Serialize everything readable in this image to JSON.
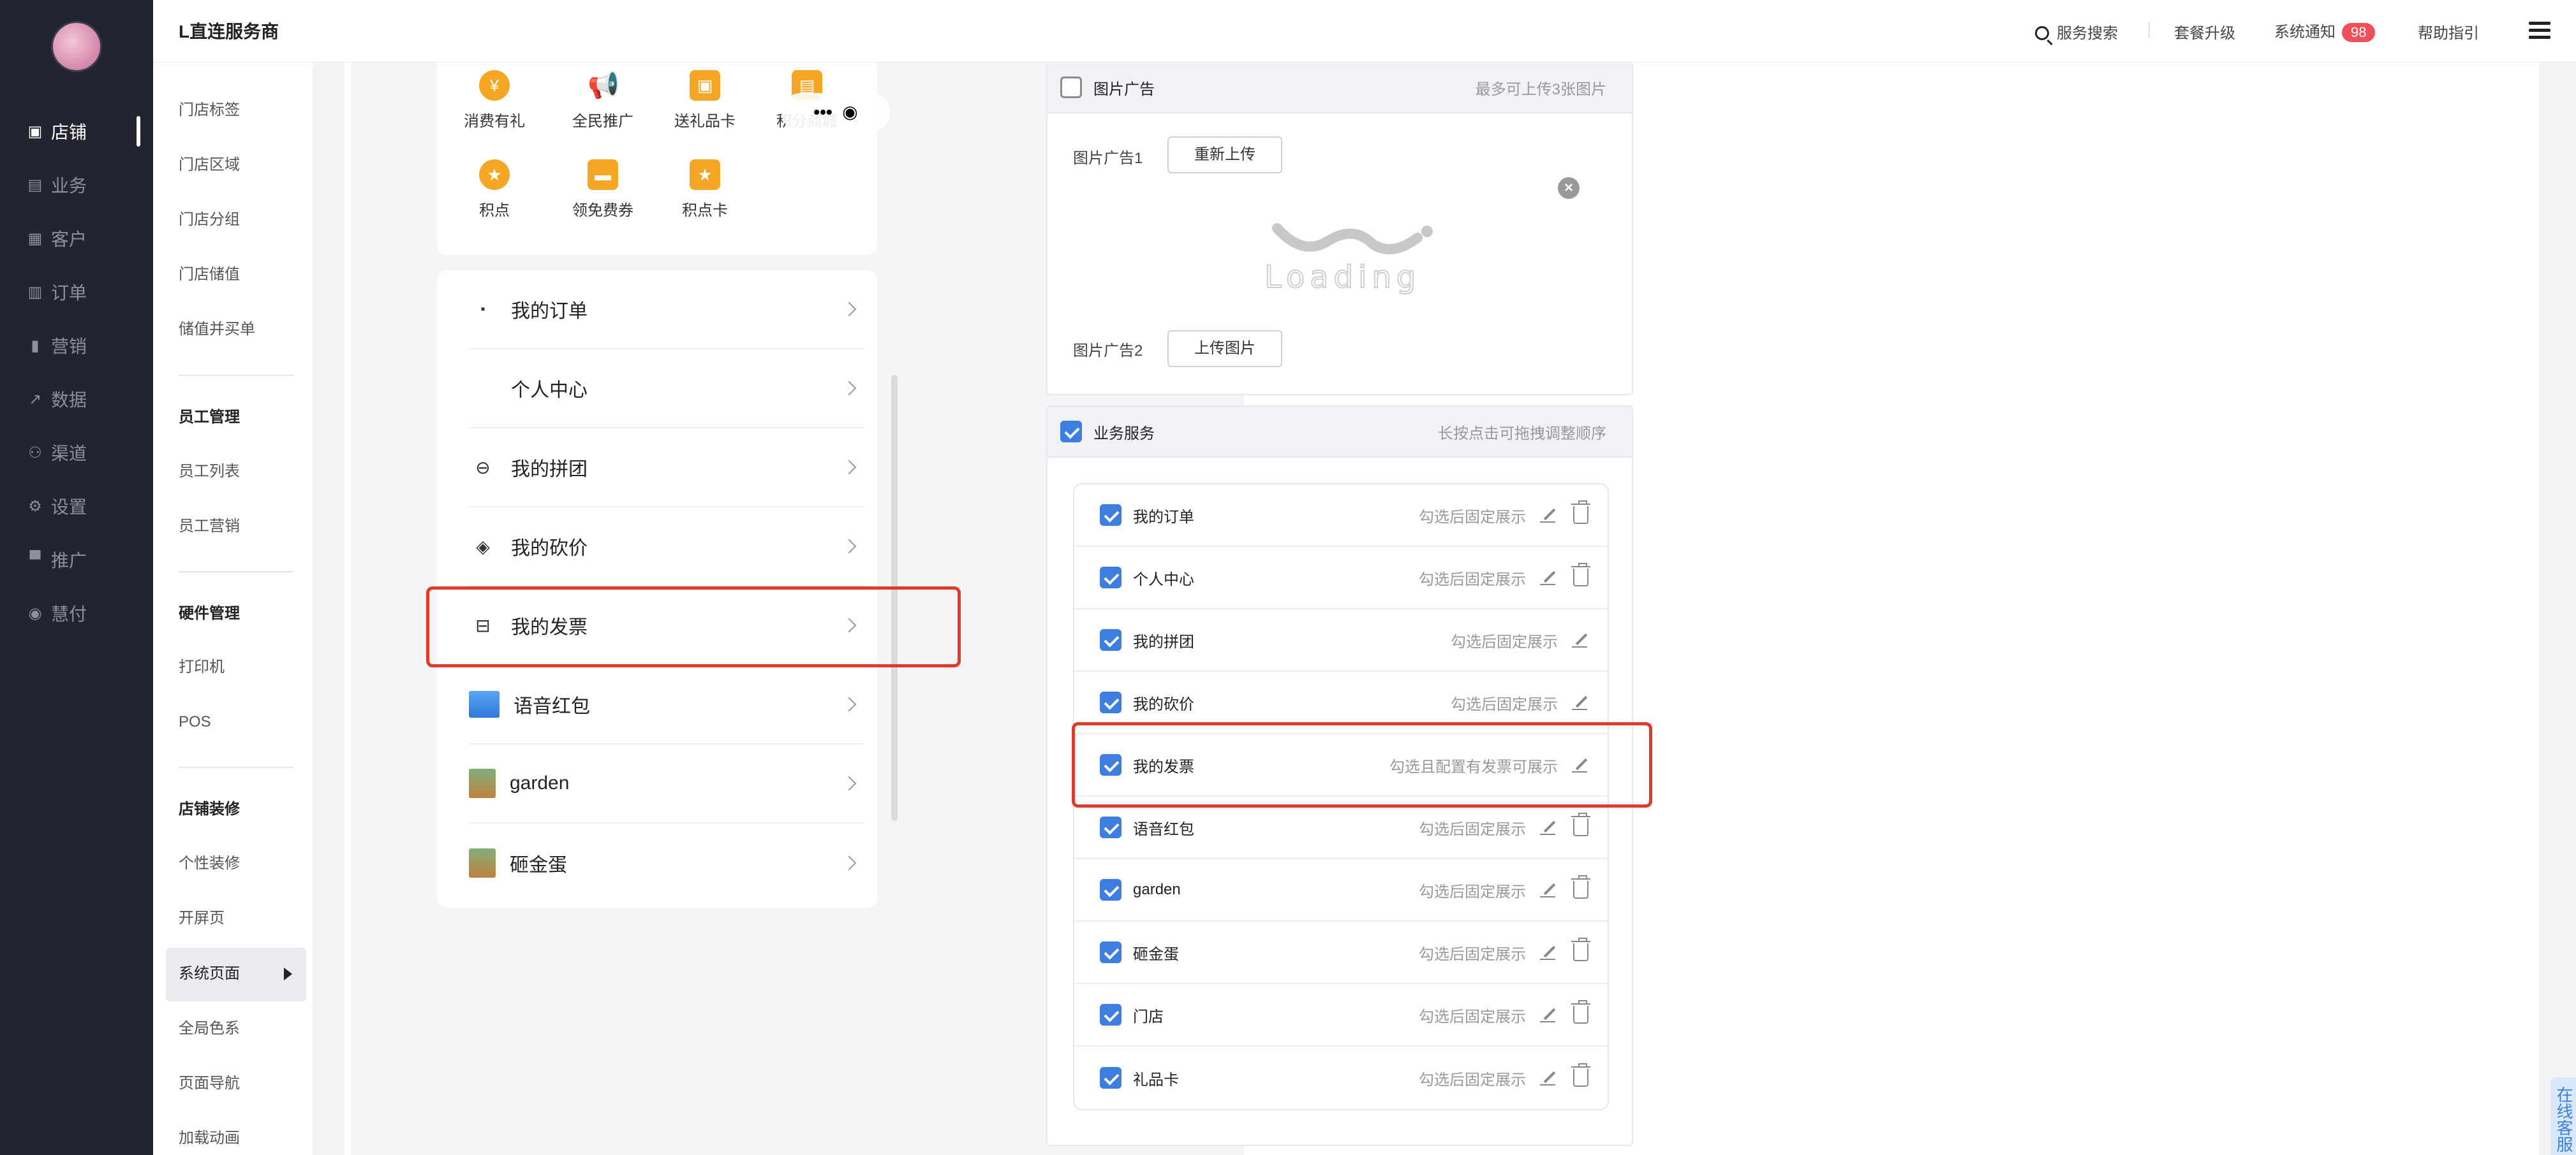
{
  "header": {
    "brand": "L直连服务商",
    "search": "服务搜索",
    "upgrade": "套餐升级",
    "notice": "系统通知",
    "notice_count": "98",
    "help": "帮助指引"
  },
  "leftnav": {
    "items": [
      {
        "label": "店铺",
        "icon": "store-icon"
      },
      {
        "label": "业务",
        "icon": "briefcase-icon"
      },
      {
        "label": "客户",
        "icon": "keyboard-icon"
      },
      {
        "label": "订单",
        "icon": "order-icon"
      },
      {
        "label": "营销",
        "icon": "bar-chart-icon"
      },
      {
        "label": "数据",
        "icon": "line-chart-icon"
      },
      {
        "label": "渠道",
        "icon": "channel-icon"
      },
      {
        "label": "设置",
        "icon": "gear-icon"
      },
      {
        "label": "推广",
        "icon": "billboard-icon"
      },
      {
        "label": "慧付",
        "icon": "pay-icon"
      }
    ]
  },
  "submenu": {
    "group1": [
      "门店标签",
      "门店区域",
      "门店分组",
      "门店储值",
      "储值并买单"
    ],
    "staff_head": "员工管理",
    "staff": [
      "员工列表",
      "员工营销"
    ],
    "hardware_head": "硬件管理",
    "hardware": [
      "打印机",
      "POS"
    ],
    "decor_head": "店铺装修",
    "decor": [
      "个性装修",
      "开屏页",
      "系统页面",
      "全局色系",
      "页面导航",
      "加载动画"
    ]
  },
  "phone": {
    "grid": [
      "消费有礼",
      "全民推广",
      "送礼品卡",
      "积分商城",
      "积点",
      "领免费券",
      "积点卡"
    ],
    "list": [
      "我的订单",
      "个人中心",
      "我的拼团",
      "我的砍价",
      "我的发票",
      "语音红包",
      "garden",
      "砸金蛋"
    ]
  },
  "image_ad": {
    "title": "图片广告",
    "hint": "最多可上传3张图片",
    "ad1_label": "图片广告1",
    "ad1_btn": "重新上传",
    "ad2_label": "图片广告2",
    "ad2_btn": "上传图片",
    "loading_text": "Loading"
  },
  "services": {
    "title": "业务服务",
    "hint": "长按点击可拖拽调整顺序",
    "rows": [
      {
        "name": "我的订单",
        "hint": "勾选后固定展示"
      },
      {
        "name": "个人中心",
        "hint": "勾选后固定展示"
      },
      {
        "name": "我的拼团",
        "hint": "勾选后固定展示"
      },
      {
        "name": "我的砍价",
        "hint": "勾选后固定展示"
      },
      {
        "name": "我的发票",
        "hint": "勾选且配置有发票可展示"
      },
      {
        "name": "语音红包",
        "hint": "勾选后固定展示"
      },
      {
        "name": "garden",
        "hint": "勾选后固定展示"
      },
      {
        "name": "砸金蛋",
        "hint": "勾选后固定展示"
      },
      {
        "name": "门店",
        "hint": "勾选后固定展示"
      },
      {
        "name": "礼品卡",
        "hint": "勾选后固定展示"
      }
    ]
  },
  "online_service": "在线客服"
}
